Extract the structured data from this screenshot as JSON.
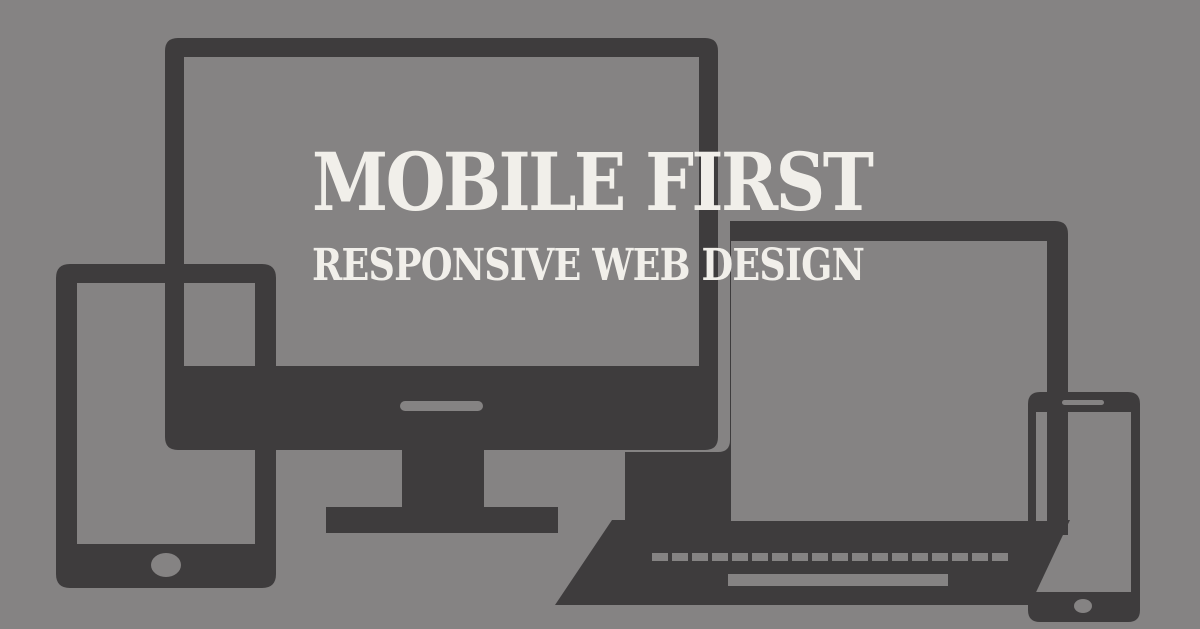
{
  "banner": {
    "title": "MOBILE FIRST",
    "subtitle": "RESPONSIVE WEB DESIGN"
  },
  "colors": {
    "background": "#858383",
    "device": "#3e3c3d",
    "text": "#f1efea"
  },
  "icons": [
    "desktop-monitor-icon",
    "tablet-icon",
    "laptop-icon",
    "smartphone-icon"
  ]
}
